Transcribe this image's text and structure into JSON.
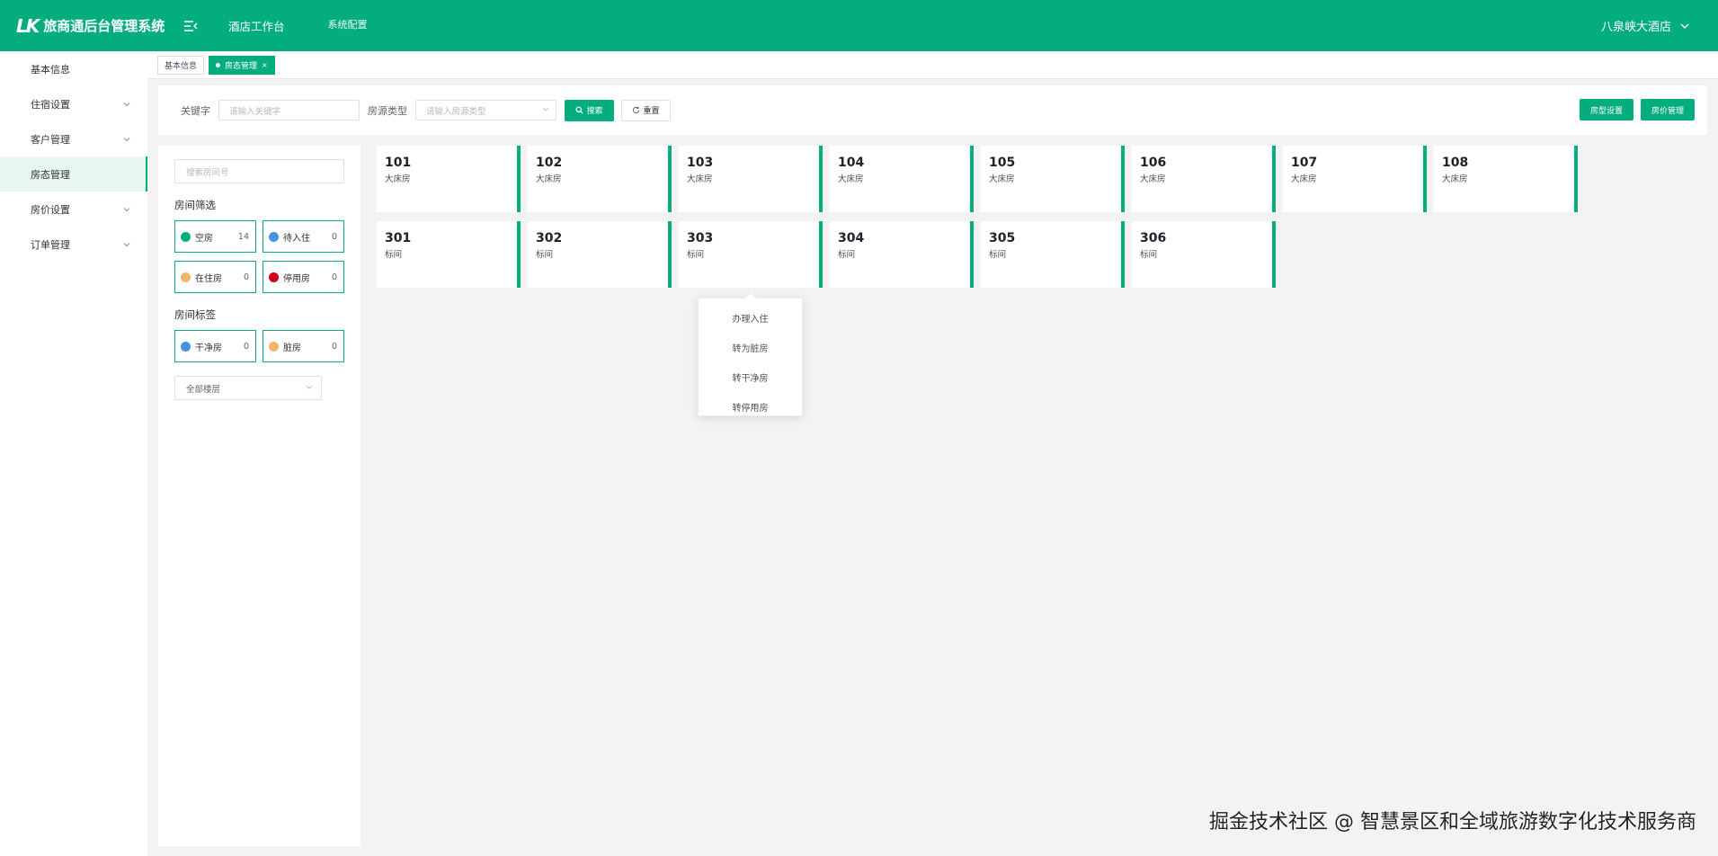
{
  "app": {
    "title": "旅商通后台管理系统",
    "logo_mark": "LK",
    "brand_color": "#04ad7e"
  },
  "topnav": {
    "items": [
      {
        "label": "酒店工作台"
      },
      {
        "label": "系统配置"
      }
    ],
    "hotel_name": "八泉峡大酒店"
  },
  "sidebar": {
    "items": [
      {
        "label": "基本信息"
      },
      {
        "label": "住宿设置"
      },
      {
        "label": "客户管理"
      },
      {
        "label": "房态管理"
      },
      {
        "label": "房价设置"
      },
      {
        "label": "订单管理"
      }
    ]
  },
  "tags": {
    "items": [
      {
        "label": "基本信息"
      },
      {
        "label": "房态管理"
      }
    ],
    "close_glyph": "×"
  },
  "search": {
    "keyword_label": "关键字",
    "keyword_placeholder": "请输入关键字",
    "type_label": "房源类型",
    "type_placeholder": "请输入房源类型",
    "search_button": "搜索",
    "reset_button": "重置",
    "room_type_settings_button": "房型设置",
    "room_price_button": "房价管理"
  },
  "filter": {
    "room_search_placeholder": "搜索房间号",
    "status_title": "房间筛选",
    "status": [
      {
        "label": "空房",
        "count": "14",
        "color": "#04ad7e"
      },
      {
        "label": "待入住",
        "count": "0",
        "color": "#4a90e2"
      },
      {
        "label": "在住房",
        "count": "0",
        "color": "#f5b46b"
      },
      {
        "label": "停用房",
        "count": "0",
        "color": "#d0021b"
      }
    ],
    "tag_title": "房间标签",
    "tags": [
      {
        "label": "干净房",
        "count": "0",
        "color": "#4a90e2"
      },
      {
        "label": "脏房",
        "count": "0",
        "color": "#f5b46b"
      }
    ],
    "floor_select": "全部楼层"
  },
  "rooms": [
    {
      "number": "101",
      "type": "大床房"
    },
    {
      "number": "102",
      "type": "大床房"
    },
    {
      "number": "103",
      "type": "大床房"
    },
    {
      "number": "104",
      "type": "大床房"
    },
    {
      "number": "105",
      "type": "大床房"
    },
    {
      "number": "106",
      "type": "大床房"
    },
    {
      "number": "107",
      "type": "大床房"
    },
    {
      "number": "108",
      "type": "大床房"
    },
    {
      "number": "301",
      "type": "标间"
    },
    {
      "number": "302",
      "type": "标间"
    },
    {
      "number": "303",
      "type": "标间"
    },
    {
      "number": "304",
      "type": "标间"
    },
    {
      "number": "305",
      "type": "标间"
    },
    {
      "number": "306",
      "type": "标间"
    }
  ],
  "context_menu": {
    "items": [
      {
        "label": "办理入住"
      },
      {
        "label": "转为脏房"
      },
      {
        "label": "转干净房"
      },
      {
        "label": "转停用房"
      }
    ]
  },
  "watermark": "掘金技术社区 @ 智慧景区和全域旅游数字化技术服务商"
}
